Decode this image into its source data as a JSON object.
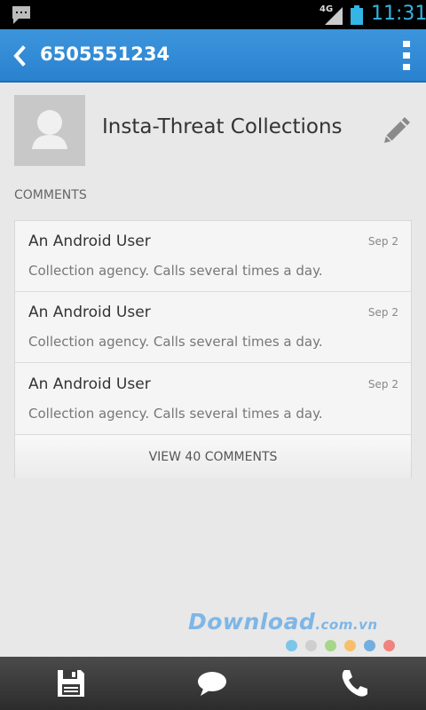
{
  "status_bar": {
    "network": "4G",
    "time": "11:31"
  },
  "action_bar": {
    "title": "6505551234"
  },
  "contact": {
    "name": "Insta-Threat Collections"
  },
  "comments": {
    "header": "COMMENTS",
    "items": [
      {
        "user": "An Android User",
        "date": "Sep 2",
        "text": "Collection agency. Calls several times a day."
      },
      {
        "user": "An Android User",
        "date": "Sep 2",
        "text": "Collection agency. Calls several times a day."
      },
      {
        "user": "An Android User",
        "date": "Sep 2",
        "text": "Collection agency. Calls several times a day."
      }
    ],
    "view_all_label": "VIEW 40 COMMENTS"
  },
  "watermark": {
    "main": "Download",
    "suffix": ".com.vn"
  },
  "colors": {
    "accent": "#2f8ad6",
    "clock": "#33b5e5"
  },
  "icons": {
    "status": [
      "chat-notification-icon",
      "signal-icon",
      "battery-icon"
    ],
    "action_bar": [
      "back-icon",
      "overflow-menu-icon"
    ],
    "bottom_bar": [
      "save-icon",
      "message-icon",
      "phone-icon"
    ],
    "edit": "pencil-icon"
  }
}
